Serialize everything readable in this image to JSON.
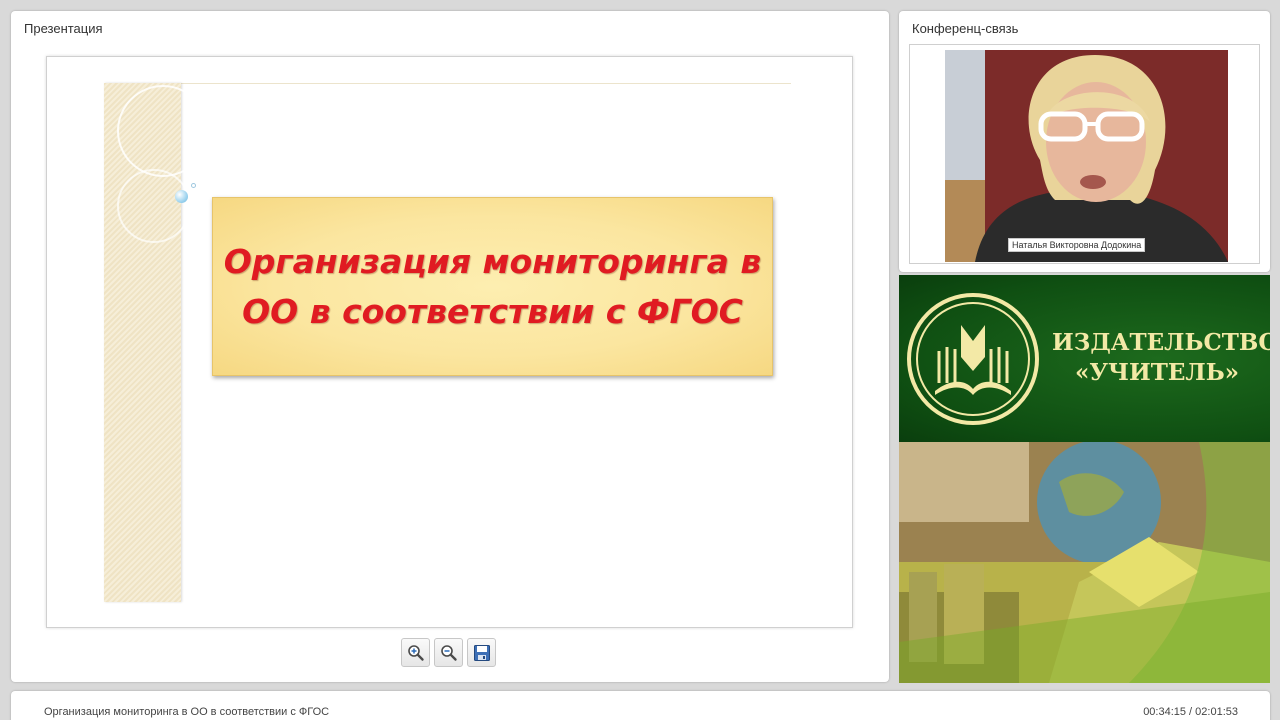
{
  "presentation": {
    "title": "Презентация",
    "slide_title": "Организация мониторинга в ОО в соответствии с ФГОС",
    "toolbar": {
      "zoom_in_icon": "zoom-in-icon",
      "zoom_out_icon": "zoom-out-icon",
      "save_icon": "save-icon"
    }
  },
  "conference": {
    "title": "Конференц-связь",
    "speaker_name": "Наталья Викторовна Додокина"
  },
  "banner": {
    "publisher_name": "ИЗДАТЕЛЬСТВО «УЧИТЕЛЬ»"
  },
  "footer": {
    "lecture_title": "Организация мониторинга в ОО в соответствии с ФГОС",
    "time": "00:34:15 / 02:01:53"
  },
  "colors": {
    "slide_title": "#e01b22",
    "title_box": "#fbe6a0",
    "banner_green": "#0f4f12",
    "banner_text": "#f3e9a6"
  }
}
